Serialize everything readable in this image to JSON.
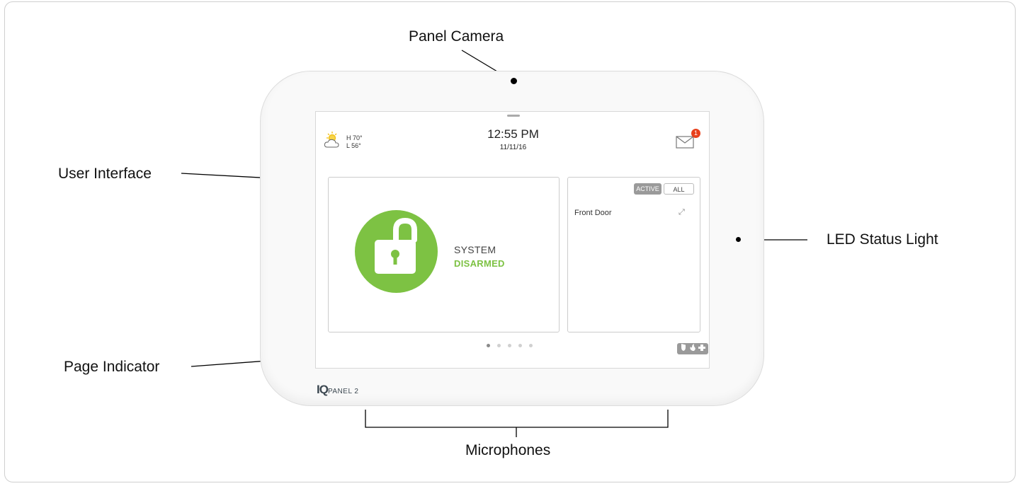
{
  "callouts": {
    "panel_camera": "Panel Camera",
    "user_interface": "User Interface",
    "led_status_light": "LED Status Light",
    "page_indicator": "Page Indicator",
    "microphones": "Microphones"
  },
  "device": {
    "brand_iq": "IQ",
    "brand_panel": "PANEL 2"
  },
  "screen": {
    "weather": {
      "high": "H 70°",
      "low": "L 56°",
      "icon": "partly-sunny-icon"
    },
    "time": "12:55 PM",
    "date": "11/11/16",
    "notifications_badge": "1",
    "system_label": "SYSTEM",
    "system_status": "DISARMED",
    "tabs": {
      "active": "ACTIVE",
      "all": "ALL"
    },
    "sensors": [
      {
        "name": "Front Door"
      }
    ],
    "page_count": 5,
    "current_page": 1
  },
  "colors": {
    "accent_green": "#7dc243",
    "badge_red": "#e8401c",
    "tab_gray": "#9a9a9a"
  }
}
